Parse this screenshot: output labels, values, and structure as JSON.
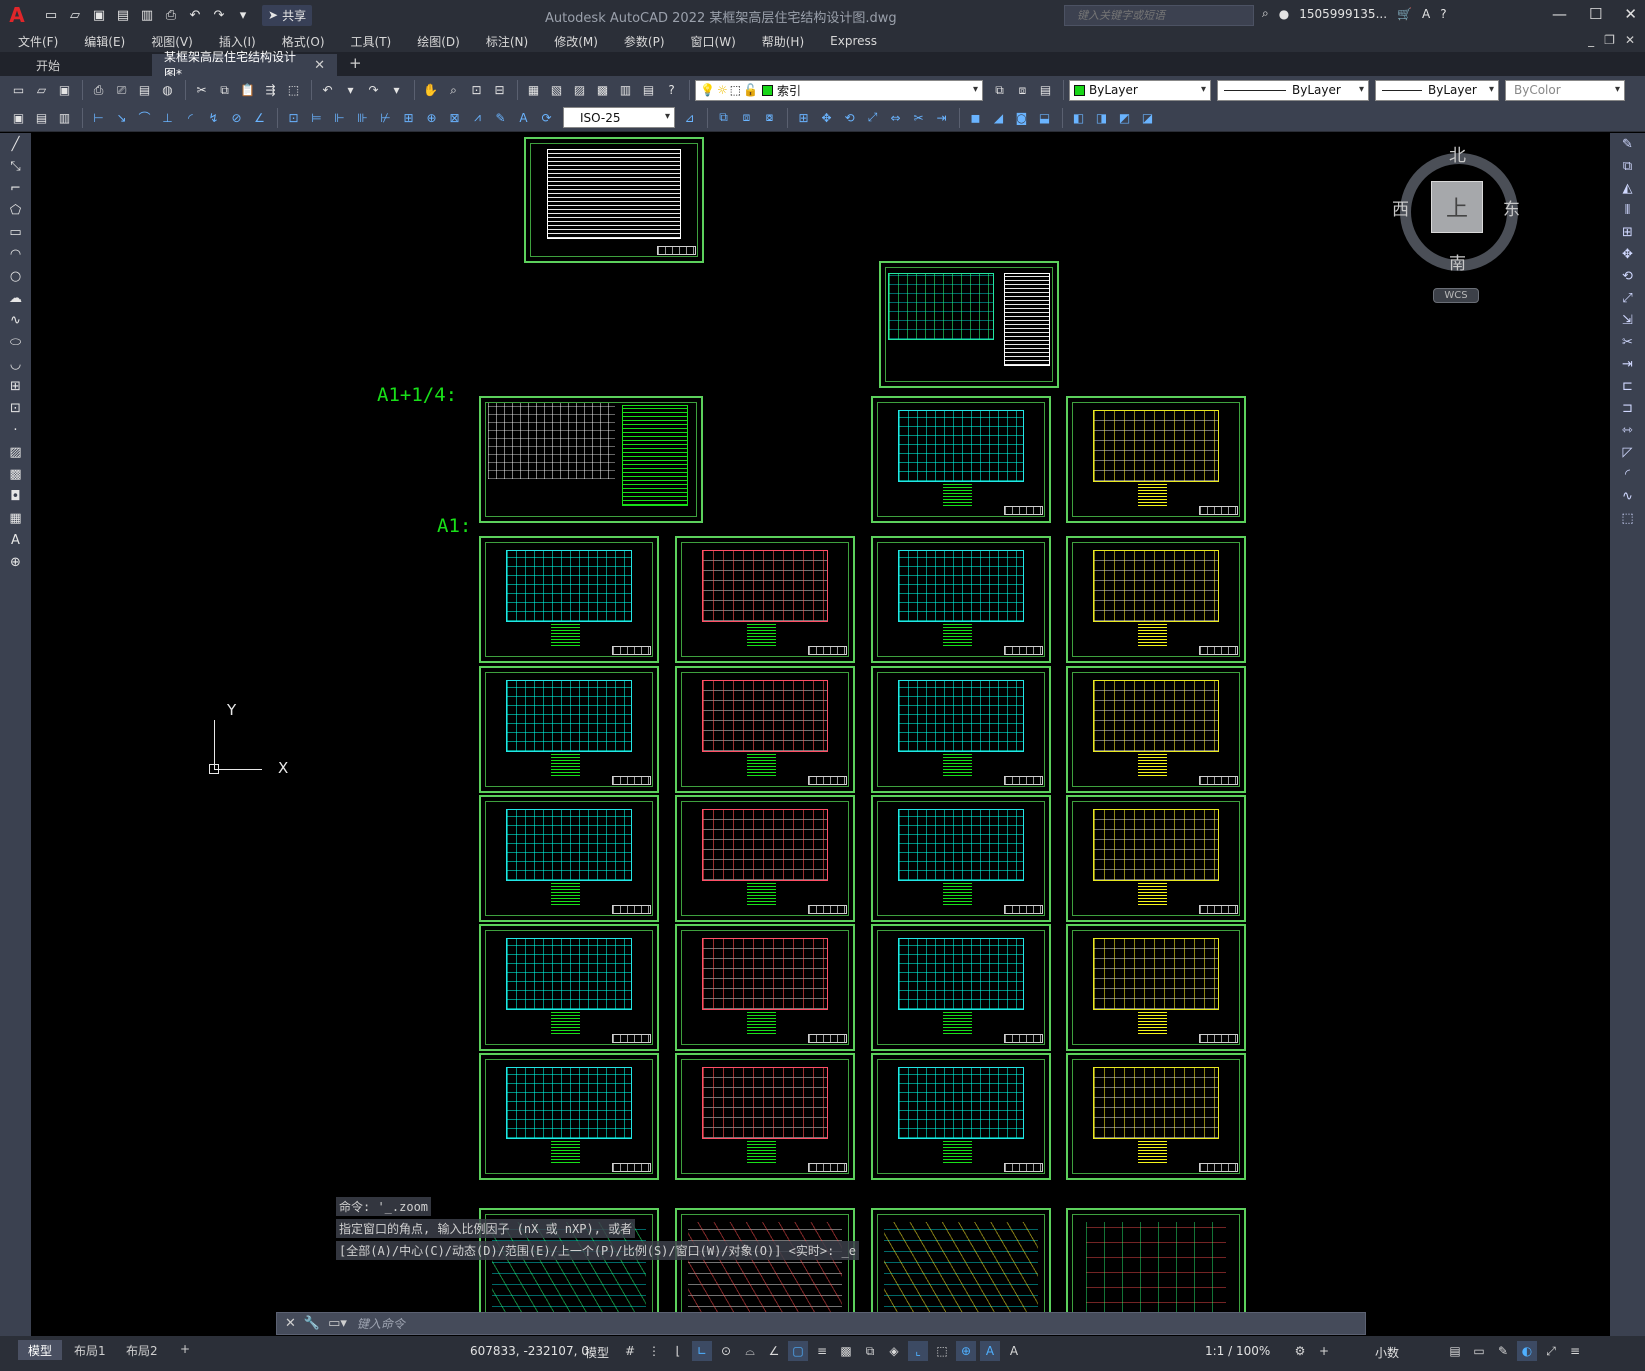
{
  "titlebar": {
    "app_title": "Autodesk AutoCAD 2022    某框架高层住宅结构设计图.dwg",
    "share": "共享",
    "search_placeholder": "键入关键字或短语",
    "account": "1505999135...",
    "qat_icons": [
      "new-icon",
      "open-icon",
      "save-icon",
      "saveas-icon",
      "publish-icon",
      "plot-icon",
      "undo-icon",
      "redo-icon"
    ]
  },
  "menu": {
    "items": [
      "文件(F)",
      "编辑(E)",
      "视图(V)",
      "插入(I)",
      "格式(O)",
      "工具(T)",
      "绘图(D)",
      "标注(N)",
      "修改(M)",
      "参数(P)",
      "窗口(W)",
      "帮助(H)",
      "Express"
    ]
  },
  "tabs": {
    "start": "开始",
    "active": "某框架高层住宅结构设计图*"
  },
  "toolbar": {
    "layer_name": "索引",
    "color": "ByLayer",
    "linetype": "ByLayer",
    "lineweight": "ByLayer",
    "plotstyle": "ByColor",
    "dimstyle": "ISO-25",
    "layer_color": "#19d619"
  },
  "canvas": {
    "label_a1q": "A1+1/4:",
    "label_a1": "A1:",
    "ucs_y": "Y",
    "ucs_x": "X",
    "sheet_count": 28
  },
  "viewcube": {
    "north": "北",
    "south": "南",
    "east": "东",
    "west": "西",
    "face": "上",
    "wcs": "WCS"
  },
  "command": {
    "history": [
      "命令: '_.zoom",
      "指定窗口的角点, 输入比例因子 (nX 或 nXP), 或者",
      "[全部(A)/中心(C)/动态(D)/范围(E)/上一个(P)/比例(S)/窗口(W)/对象(O)] <实时>: _e"
    ],
    "placeholder": "键入命令"
  },
  "statusbar": {
    "tab_model": "模型",
    "tab_layout1": "布局1",
    "tab_layout2": "布局2",
    "coords": "607833, -232107, 0",
    "model": "模型",
    "scale": "1:1 / 100%",
    "units": "小数"
  }
}
